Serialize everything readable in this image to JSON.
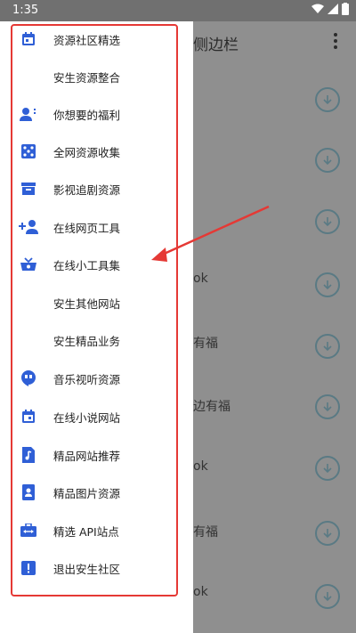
{
  "statusbar": {
    "time": "1:35"
  },
  "background": {
    "title": "侧边栏",
    "rows": [
      "ok",
      "有福",
      "边有福",
      "ok",
      "有福",
      "ok"
    ]
  },
  "drawer": {
    "items": [
      {
        "label": "资源社区精选",
        "icon": "calendar-icon"
      },
      {
        "label": "安生资源整合",
        "icon": ""
      },
      {
        "label": "你想要的福利",
        "icon": "person-talk-icon"
      },
      {
        "label": "全网资源收集",
        "icon": "dice-icon"
      },
      {
        "label": "影视追剧资源",
        "icon": "archive-icon"
      },
      {
        "label": "在线网页工具",
        "icon": "person-add-icon"
      },
      {
        "label": "在线小工具集",
        "icon": "basket-icon"
      },
      {
        "label": "安生其他网站",
        "icon": ""
      },
      {
        "label": "安生精品业务",
        "icon": ""
      },
      {
        "label": "音乐视听资源",
        "icon": "hangouts-icon"
      },
      {
        "label": "在线小说网站",
        "icon": "calendar-icon"
      },
      {
        "label": "精品网站推荐",
        "icon": "music-file-icon"
      },
      {
        "label": "精品图片资源",
        "icon": "portrait-icon"
      },
      {
        "label": "精选 API站点",
        "icon": "briefcase-icon"
      },
      {
        "label": "退出安生社区",
        "icon": "alert-icon"
      }
    ]
  },
  "colors": {
    "accent": "#2f5fd6",
    "highlight_frame": "#e53935",
    "annotation_arrow": "#e53935"
  }
}
